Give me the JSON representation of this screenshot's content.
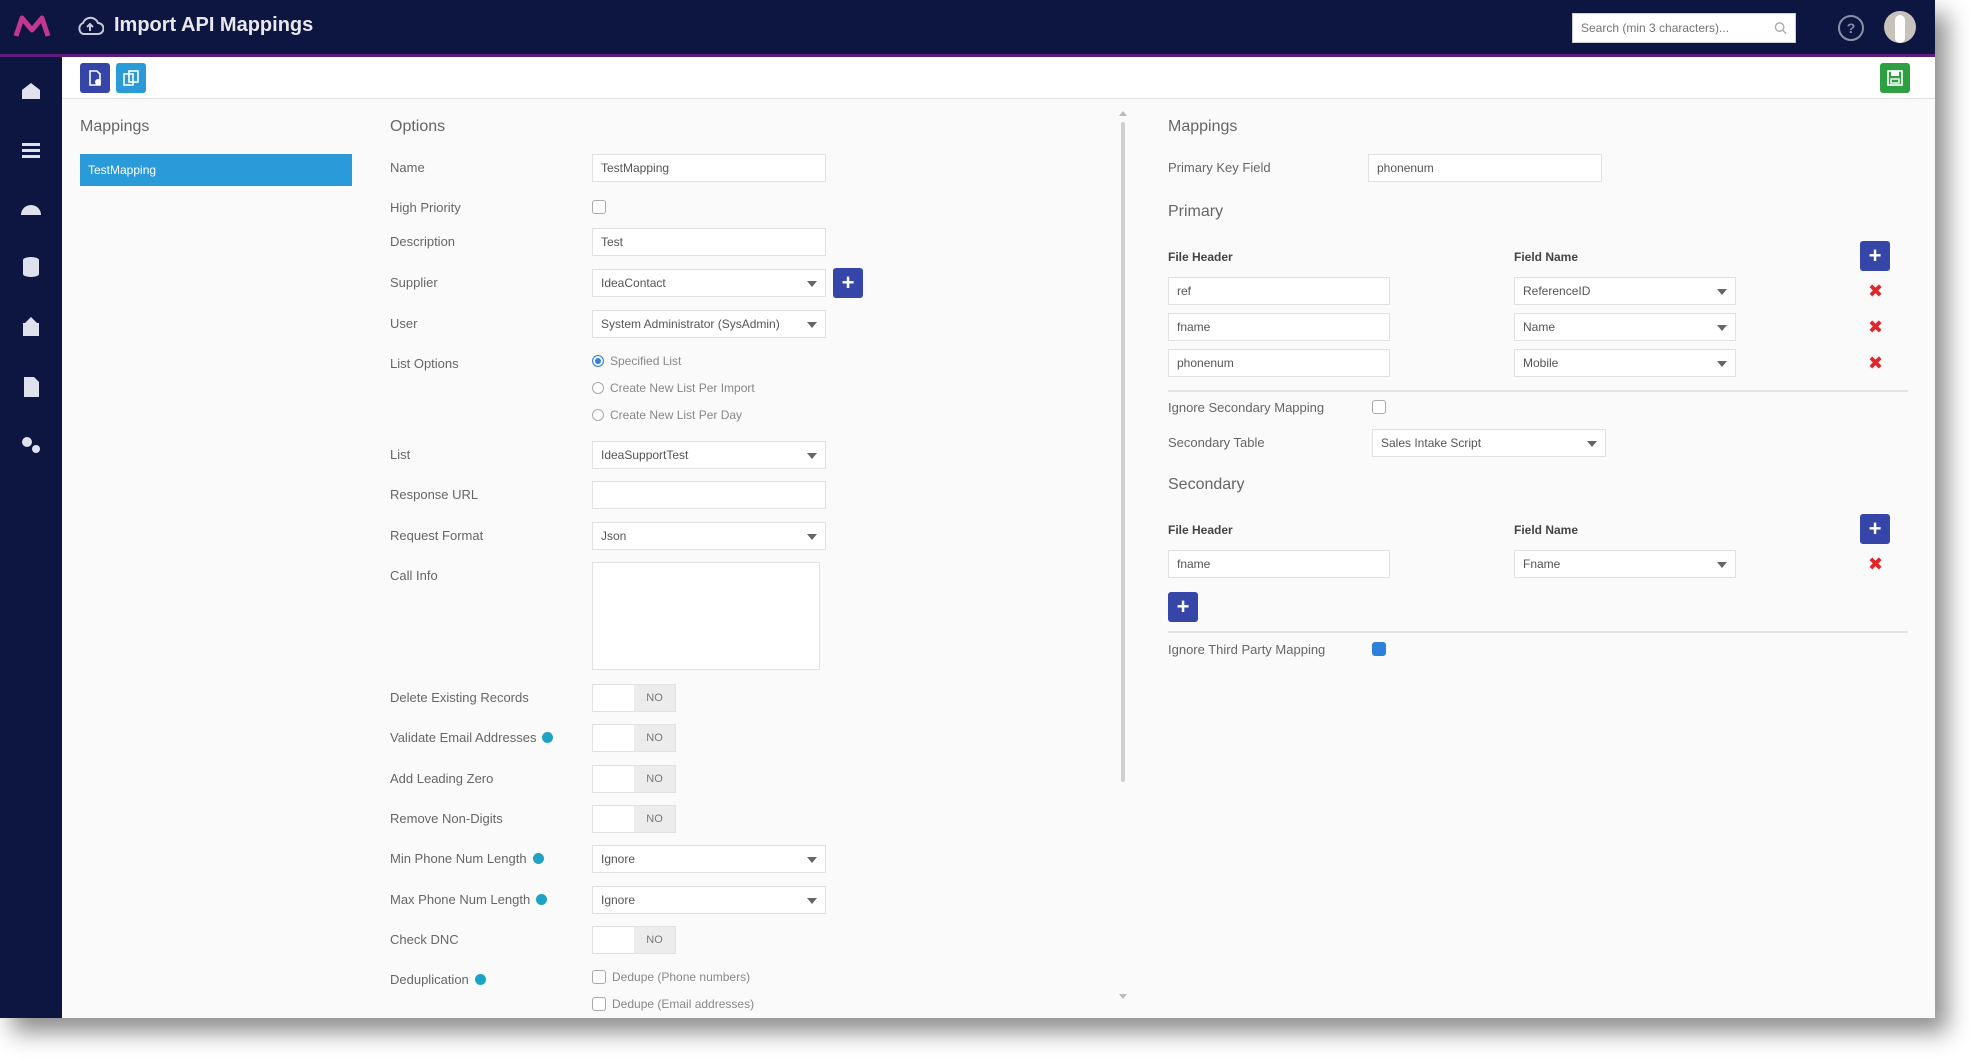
{
  "app": {
    "title": "Import API Mappings"
  },
  "header": {
    "search_placeholder": "Search (min 3 characters)...",
    "help_label": "?"
  },
  "sidebar": {
    "items": [
      {
        "icon": "home-icon"
      },
      {
        "icon": "list-icon"
      },
      {
        "icon": "dashboard-icon"
      },
      {
        "icon": "database-icon"
      },
      {
        "icon": "upload-icon"
      },
      {
        "icon": "document-icon"
      },
      {
        "icon": "settings-icon"
      }
    ]
  },
  "toolbar": {
    "new_icon": "new-document-icon",
    "copy_icon": "copy-icon",
    "save_icon": "save-icon"
  },
  "mappings_list": {
    "heading": "Mappings",
    "items": [
      "TestMapping"
    ]
  },
  "options": {
    "heading": "Options",
    "name_label": "Name",
    "name_value": "TestMapping",
    "high_priority_label": "High Priority",
    "description_label": "Description",
    "description_value": "Test",
    "supplier_label": "Supplier",
    "supplier_value": "IdeaContact",
    "user_label": "User",
    "user_value": "System Administrator (SysAdmin)",
    "list_options_label": "List Options",
    "list_options": [
      "Specified List",
      "Create New List Per Import",
      "Create New List Per Day"
    ],
    "list_label": "List",
    "list_value": "IdeaSupportTest",
    "response_url_label": "Response URL",
    "response_url_value": "",
    "request_format_label": "Request Format",
    "request_format_value": "Json",
    "call_info_label": "Call Info",
    "call_info_value": "",
    "delete_existing_label": "Delete Existing Records",
    "validate_email_label": "Validate Email Addresses",
    "add_leading_zero_label": "Add Leading Zero",
    "remove_non_digits_label": "Remove Non-Digits",
    "min_phone_label": "Min Phone Num Length",
    "min_phone_value": "Ignore",
    "max_phone_label": "Max Phone Num Length",
    "max_phone_value": "Ignore",
    "check_dnc_label": "Check DNC",
    "deduplication_label": "Deduplication",
    "dedupe_options": [
      "Dedupe (Phone numbers)",
      "Dedupe (Email addresses)"
    ],
    "toggle_off_label": "NO"
  },
  "mappings_panel": {
    "heading": "Mappings",
    "primary_key_label": "Primary Key Field",
    "primary_key_value": "phonenum",
    "primary_heading": "Primary",
    "file_header_col": "File Header",
    "field_name_col": "Field Name",
    "primary_rows": [
      {
        "file_header": "ref",
        "field_name": "ReferenceID"
      },
      {
        "file_header": "fname",
        "field_name": "Name"
      },
      {
        "file_header": "phonenum",
        "field_name": "Mobile"
      }
    ],
    "ignore_secondary_label": "Ignore Secondary Mapping",
    "secondary_table_label": "Secondary Table",
    "secondary_table_value": "Sales Intake Script",
    "secondary_heading": "Secondary",
    "secondary_rows": [
      {
        "file_header": "fname",
        "field_name": "Fname"
      }
    ],
    "ignore_third_party_label": "Ignore Third Party Mapping",
    "add_label": "+",
    "delete_label": "✖"
  },
  "colors": {
    "topbar": "#0d1541",
    "accent": "#5e1d7a",
    "selected": "#2b9ad8",
    "button": "#3545a8",
    "delete": "#e0262b",
    "save": "#2ea043"
  }
}
